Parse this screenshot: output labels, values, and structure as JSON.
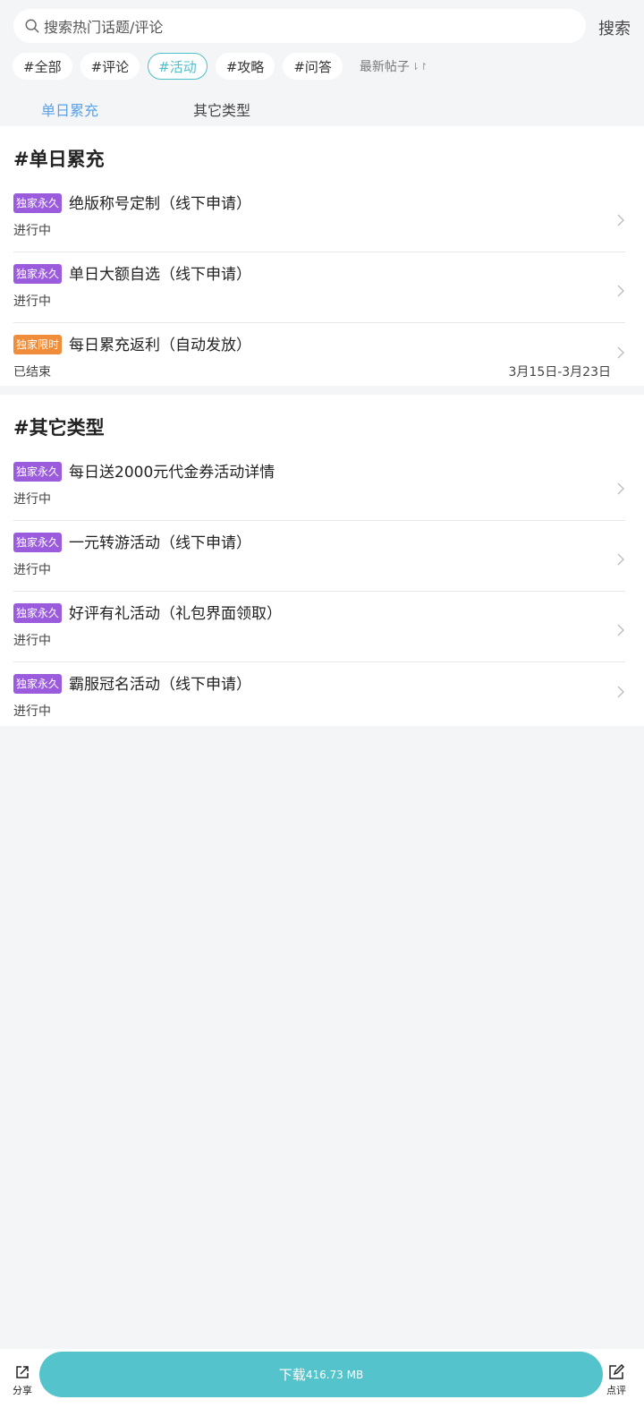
{
  "search": {
    "placeholder": "搜索热门话题/评论",
    "button": "搜索"
  },
  "chips": [
    "#全部",
    "#评论",
    "#活动",
    "#攻略",
    "#问答"
  ],
  "active_chip": "#活动",
  "sort_label": "最新帖子",
  "tabs": [
    "单日累充",
    "其它类型"
  ],
  "active_tab": "单日累充",
  "sections": [
    {
      "title": "#单日累充",
      "items": [
        {
          "badge": "独家永久",
          "badge_color": "#9a5cdc",
          "title": "绝版称号定制（线下申请）",
          "status": "进行中",
          "date": ""
        },
        {
          "badge": "独家永久",
          "badge_color": "#9a5cdc",
          "title": "单日大额自选（线下申请）",
          "status": "进行中",
          "date": ""
        },
        {
          "badge": "独家限时",
          "badge_color": "#ef8d3a",
          "title": "每日累充返利（自动发放）",
          "status": "已结束",
          "date": "3月15日-3月23日"
        }
      ]
    },
    {
      "title": "#其它类型",
      "items": [
        {
          "badge": "独家永久",
          "badge_color": "#9a5cdc",
          "title": "每日送2000元代金券活动详情",
          "status": "进行中",
          "date": ""
        },
        {
          "badge": "独家永久",
          "badge_color": "#9a5cdc",
          "title": "一元转游活动（线下申请）",
          "status": "进行中",
          "date": ""
        },
        {
          "badge": "独家永久",
          "badge_color": "#9a5cdc",
          "title": "好评有礼活动（礼包界面领取）",
          "status": "进行中",
          "date": ""
        },
        {
          "badge": "独家永久",
          "badge_color": "#9a5cdc",
          "title": "霸服冠名活动（线下申请）",
          "status": "进行中",
          "date": ""
        }
      ]
    }
  ],
  "bottom": {
    "share_label": "分享",
    "download_label": "下载",
    "download_size": "416.73 MB",
    "review_label": "点评"
  },
  "colors": {
    "accent": "#55c3cb",
    "tab_active": "#5aa3e8",
    "badge_purple": "#9a5cdc",
    "badge_orange": "#ef8d3a"
  }
}
